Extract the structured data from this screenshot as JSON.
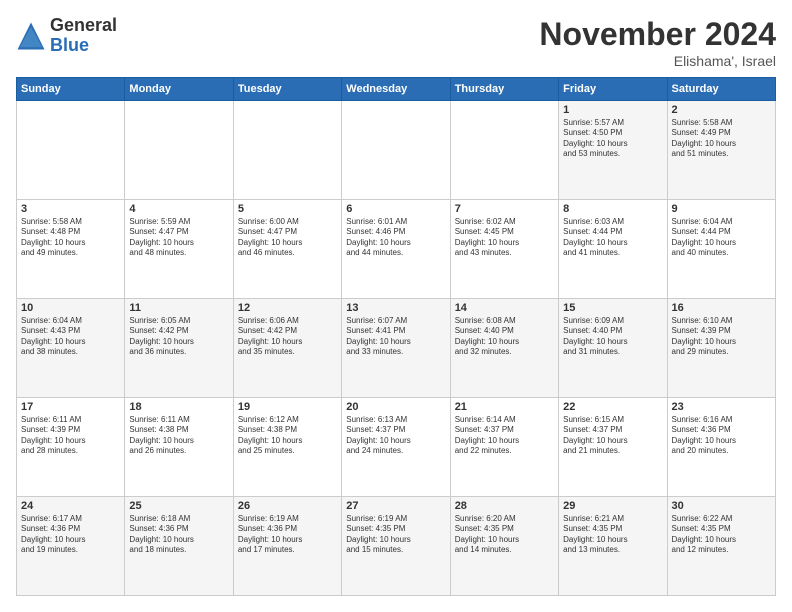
{
  "logo": {
    "general": "General",
    "blue": "Blue"
  },
  "header": {
    "month": "November 2024",
    "location": "Elishama', Israel"
  },
  "weekdays": [
    "Sunday",
    "Monday",
    "Tuesday",
    "Wednesday",
    "Thursday",
    "Friday",
    "Saturday"
  ],
  "weeks": [
    [
      {
        "day": "",
        "info": ""
      },
      {
        "day": "",
        "info": ""
      },
      {
        "day": "",
        "info": ""
      },
      {
        "day": "",
        "info": ""
      },
      {
        "day": "",
        "info": ""
      },
      {
        "day": "1",
        "info": "Sunrise: 5:57 AM\nSunset: 4:50 PM\nDaylight: 10 hours\nand 53 minutes."
      },
      {
        "day": "2",
        "info": "Sunrise: 5:58 AM\nSunset: 4:49 PM\nDaylight: 10 hours\nand 51 minutes."
      }
    ],
    [
      {
        "day": "3",
        "info": "Sunrise: 5:58 AM\nSunset: 4:48 PM\nDaylight: 10 hours\nand 49 minutes."
      },
      {
        "day": "4",
        "info": "Sunrise: 5:59 AM\nSunset: 4:47 PM\nDaylight: 10 hours\nand 48 minutes."
      },
      {
        "day": "5",
        "info": "Sunrise: 6:00 AM\nSunset: 4:47 PM\nDaylight: 10 hours\nand 46 minutes."
      },
      {
        "day": "6",
        "info": "Sunrise: 6:01 AM\nSunset: 4:46 PM\nDaylight: 10 hours\nand 44 minutes."
      },
      {
        "day": "7",
        "info": "Sunrise: 6:02 AM\nSunset: 4:45 PM\nDaylight: 10 hours\nand 43 minutes."
      },
      {
        "day": "8",
        "info": "Sunrise: 6:03 AM\nSunset: 4:44 PM\nDaylight: 10 hours\nand 41 minutes."
      },
      {
        "day": "9",
        "info": "Sunrise: 6:04 AM\nSunset: 4:44 PM\nDaylight: 10 hours\nand 40 minutes."
      }
    ],
    [
      {
        "day": "10",
        "info": "Sunrise: 6:04 AM\nSunset: 4:43 PM\nDaylight: 10 hours\nand 38 minutes."
      },
      {
        "day": "11",
        "info": "Sunrise: 6:05 AM\nSunset: 4:42 PM\nDaylight: 10 hours\nand 36 minutes."
      },
      {
        "day": "12",
        "info": "Sunrise: 6:06 AM\nSunset: 4:42 PM\nDaylight: 10 hours\nand 35 minutes."
      },
      {
        "day": "13",
        "info": "Sunrise: 6:07 AM\nSunset: 4:41 PM\nDaylight: 10 hours\nand 33 minutes."
      },
      {
        "day": "14",
        "info": "Sunrise: 6:08 AM\nSunset: 4:40 PM\nDaylight: 10 hours\nand 32 minutes."
      },
      {
        "day": "15",
        "info": "Sunrise: 6:09 AM\nSunset: 4:40 PM\nDaylight: 10 hours\nand 31 minutes."
      },
      {
        "day": "16",
        "info": "Sunrise: 6:10 AM\nSunset: 4:39 PM\nDaylight: 10 hours\nand 29 minutes."
      }
    ],
    [
      {
        "day": "17",
        "info": "Sunrise: 6:11 AM\nSunset: 4:39 PM\nDaylight: 10 hours\nand 28 minutes."
      },
      {
        "day": "18",
        "info": "Sunrise: 6:11 AM\nSunset: 4:38 PM\nDaylight: 10 hours\nand 26 minutes."
      },
      {
        "day": "19",
        "info": "Sunrise: 6:12 AM\nSunset: 4:38 PM\nDaylight: 10 hours\nand 25 minutes."
      },
      {
        "day": "20",
        "info": "Sunrise: 6:13 AM\nSunset: 4:37 PM\nDaylight: 10 hours\nand 24 minutes."
      },
      {
        "day": "21",
        "info": "Sunrise: 6:14 AM\nSunset: 4:37 PM\nDaylight: 10 hours\nand 22 minutes."
      },
      {
        "day": "22",
        "info": "Sunrise: 6:15 AM\nSunset: 4:37 PM\nDaylight: 10 hours\nand 21 minutes."
      },
      {
        "day": "23",
        "info": "Sunrise: 6:16 AM\nSunset: 4:36 PM\nDaylight: 10 hours\nand 20 minutes."
      }
    ],
    [
      {
        "day": "24",
        "info": "Sunrise: 6:17 AM\nSunset: 4:36 PM\nDaylight: 10 hours\nand 19 minutes."
      },
      {
        "day": "25",
        "info": "Sunrise: 6:18 AM\nSunset: 4:36 PM\nDaylight: 10 hours\nand 18 minutes."
      },
      {
        "day": "26",
        "info": "Sunrise: 6:19 AM\nSunset: 4:36 PM\nDaylight: 10 hours\nand 17 minutes."
      },
      {
        "day": "27",
        "info": "Sunrise: 6:19 AM\nSunset: 4:35 PM\nDaylight: 10 hours\nand 15 minutes."
      },
      {
        "day": "28",
        "info": "Sunrise: 6:20 AM\nSunset: 4:35 PM\nDaylight: 10 hours\nand 14 minutes."
      },
      {
        "day": "29",
        "info": "Sunrise: 6:21 AM\nSunset: 4:35 PM\nDaylight: 10 hours\nand 13 minutes."
      },
      {
        "day": "30",
        "info": "Sunrise: 6:22 AM\nSunset: 4:35 PM\nDaylight: 10 hours\nand 12 minutes."
      }
    ]
  ]
}
